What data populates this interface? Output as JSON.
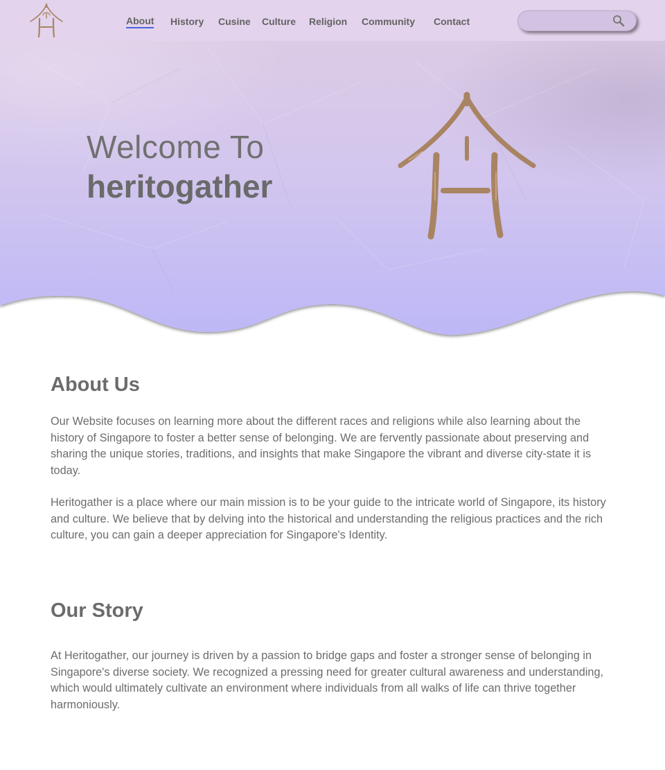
{
  "header": {
    "nav": [
      {
        "label": "About",
        "active": true
      },
      {
        "label": "History"
      },
      {
        "label": "Cusine"
      },
      {
        "label": "Culture"
      },
      {
        "label": "Religion"
      },
      {
        "label": "Community"
      },
      {
        "label": "Contact"
      }
    ],
    "search": {
      "placeholder": "",
      "icon": "search-icon"
    },
    "logo_icon": "house-logo-icon"
  },
  "hero": {
    "welcome": "Welcome To",
    "brand": "heritogather"
  },
  "about": {
    "title": "About Us",
    "paragraphs": [
      "Our Website focuses on learning more about the different races and religions while also learning about the history of Singapore to foster a better sense of belonging. We are fervently passionate about preserving and sharing the unique stories, traditions, and insights that make Singapore the vibrant and diverse city-state it is today.",
      "Heritogather is a place where our main mission is to be your guide to the intricate world of Singapore, its history and culture. We believe that by delving into the historical and understanding the religious practices and the rich culture, you can gain a deeper appreciation for Singapore's Identity."
    ]
  },
  "story": {
    "title": "Our Story",
    "paragraphs": [
      "At Heritogather, our journey is driven by a passion to bridge gaps and foster a stronger sense of belonging in Singapore's diverse society. We recognized a pressing need for greater cultural awareness and understanding, which would ultimately cultivate an environment where individuals from all walks of life can thrive together harmoniously."
    ]
  },
  "colors": {
    "header_bg": "#e3d3ec",
    "hero_top": "#dfcfe8",
    "hero_bottom": "#c2bdf6",
    "logo_brown": "#a88463",
    "nav_underline": "#4a62e0",
    "text_gray": "#6c6c6c"
  }
}
